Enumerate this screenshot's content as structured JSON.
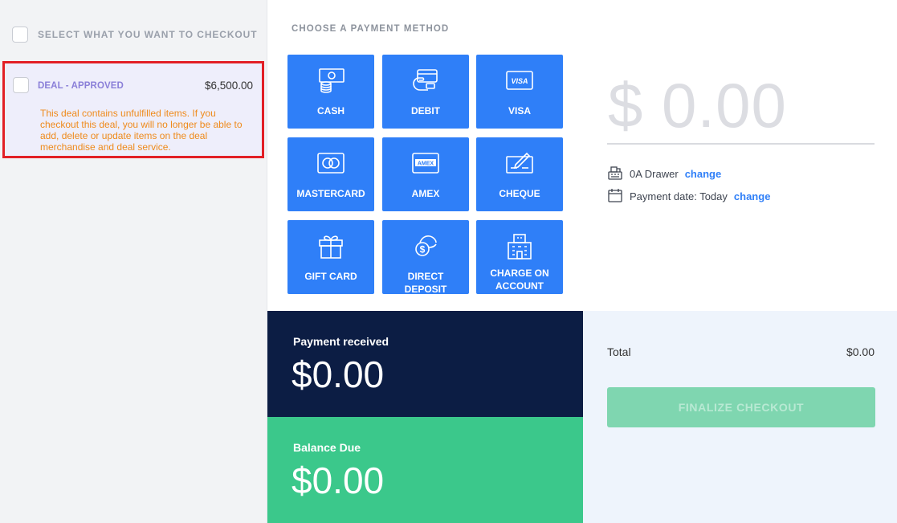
{
  "checkout": {
    "select_all_label": "SELECT WHAT YOU WANT TO CHECKOUT",
    "deal": {
      "title": "DEAL - APPROVED",
      "amount": "$6,500.00",
      "warning": "This deal contains unfulfilled items. If you checkout this deal, you will no longer be able to add, delete or update items on the deal merchandise and deal service."
    }
  },
  "payment": {
    "title": "CHOOSE A PAYMENT METHOD",
    "methods": [
      {
        "label": "CASH",
        "icon": "cash-icon"
      },
      {
        "label": "DEBIT",
        "icon": "debit-card-icon"
      },
      {
        "label": "VISA",
        "icon": "visa-icon"
      },
      {
        "label": "MASTERCARD",
        "icon": "mastercard-icon"
      },
      {
        "label": "AMEX",
        "icon": "amex-icon"
      },
      {
        "label": "CHEQUE",
        "icon": "cheque-icon"
      },
      {
        "label": "GIFT CARD",
        "icon": "gift-icon"
      },
      {
        "label": "DIRECT DEPOSIT",
        "icon": "deposit-icon"
      },
      {
        "label": "CHARGE ON ACCOUNT",
        "icon": "building-icon"
      }
    ],
    "amount": "$ 0.00",
    "drawer": {
      "label": "0A Drawer",
      "link": "change"
    },
    "payment_date": {
      "label": "Payment date: Today",
      "link": "change"
    }
  },
  "summary": {
    "received_label": "Payment received",
    "received_value": "$0.00",
    "balance_label": "Balance Due",
    "balance_value": "$0.00",
    "total_label": "Total",
    "total_value": "$0.00",
    "finalize_label": "FINALIZE CHECKOUT"
  },
  "colors": {
    "primary": "#2f7ff8",
    "navy": "#0c1d44",
    "green": "#3bc88b",
    "warning": "#ef8a1b",
    "highlight_border": "#e21f26"
  }
}
